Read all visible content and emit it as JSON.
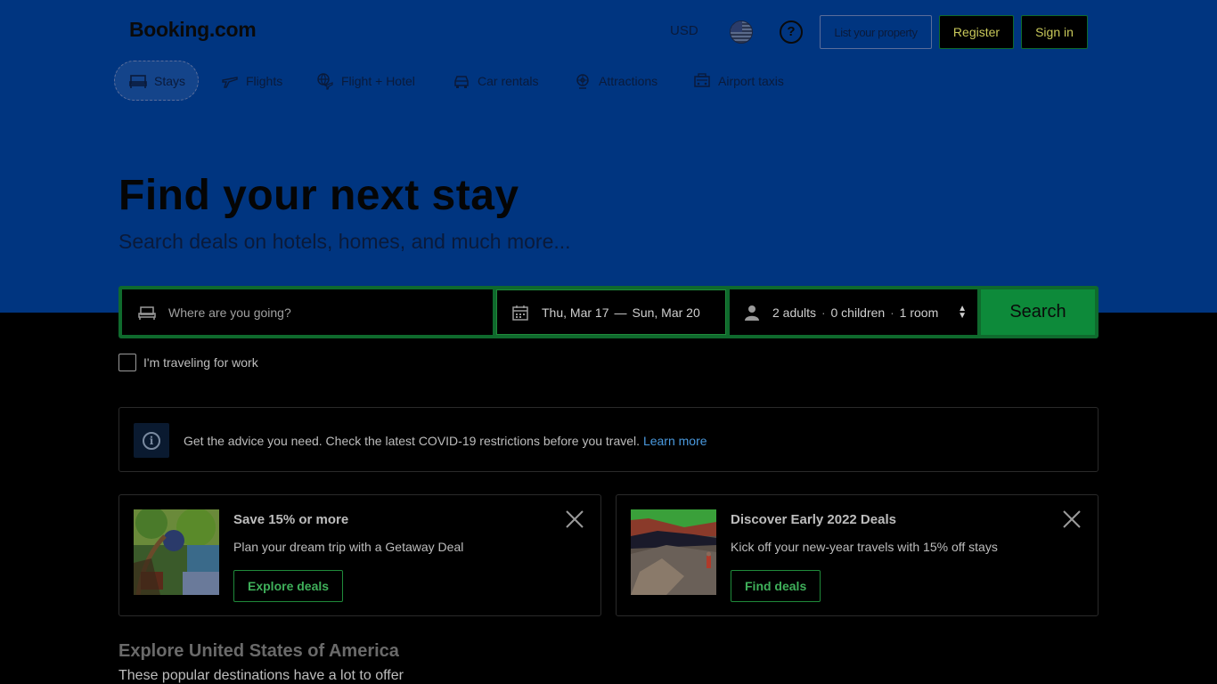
{
  "header": {
    "logo": "Booking.com",
    "currency": "USD",
    "help_icon": "help-circle-icon",
    "list_property_label": "List your property",
    "register_label": "Register",
    "signin_label": "Sign in"
  },
  "nav": {
    "tabs": [
      {
        "label": "Stays",
        "icon": "bed-icon",
        "active": true
      },
      {
        "label": "Flights",
        "icon": "plane-icon"
      },
      {
        "label": "Flight + Hotel",
        "icon": "plane-globe-icon"
      },
      {
        "label": "Car rentals",
        "icon": "car-icon"
      },
      {
        "label": "Attractions",
        "icon": "attractions-icon"
      },
      {
        "label": "Airport taxis",
        "icon": "taxi-icon"
      }
    ]
  },
  "hero": {
    "title": "Find your next stay",
    "subtitle": "Search deals on hotels, homes, and much more..."
  },
  "search": {
    "destination_placeholder": "Where are you going?",
    "checkin": "Thu, Mar 17",
    "date_separator": "—",
    "checkout": "Sun, Mar 20",
    "adults": "2 adults",
    "children": "0 children",
    "rooms": "1 room",
    "dot": "·",
    "search_label": "Search"
  },
  "work_travel_label": "I'm traveling for work",
  "notice": {
    "text": "Get the advice you need. Check the latest COVID-19 restrictions before you travel.",
    "link": "Learn more"
  },
  "promos": [
    {
      "title": "Save 15% or more",
      "description": "Plan your dream trip with a Getaway Deal",
      "button": "Explore deals"
    },
    {
      "title": "Discover Early 2022 Deals",
      "description": "Kick off your new-year travels with 15% off stays",
      "button": "Find deals"
    }
  ],
  "explore": {
    "title": "Explore United States of America",
    "subtitle": "These popular destinations have a lot to offer"
  },
  "colors": {
    "hero_blue": "#003580",
    "accent_green": "#0f6a2d",
    "link_blue": "#4a9adf"
  }
}
